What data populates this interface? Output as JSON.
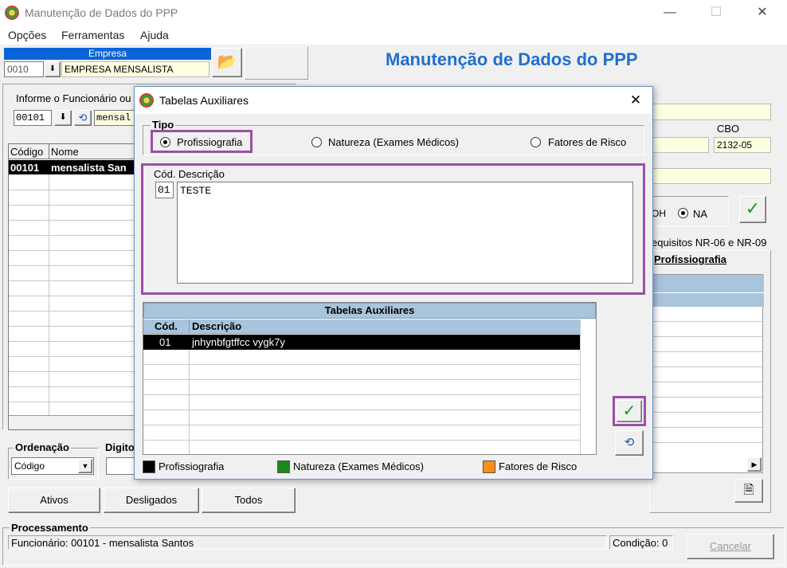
{
  "window": {
    "title": "Manutenção de Dados do PPP"
  },
  "menu": [
    "Opções",
    "Ferramentas",
    "Ajuda"
  ],
  "empresa": {
    "label": "Empresa",
    "code": "0010",
    "name": "EMPRESA MENSALISTA"
  },
  "header_title": "Manutenção de Dados do PPP",
  "funcionario": {
    "label": "Informe o Funcionário ou",
    "code": "00101",
    "name": "mensal"
  },
  "emp_table": {
    "col_code": "Código",
    "col_name": "Nome",
    "rows": [
      {
        "code": "00101",
        "name": "mensalista San"
      }
    ]
  },
  "right_panel": {
    "cbo_label": "CBO",
    "cbo_value": "2132-05",
    "radio_partial": "OH",
    "radio_na": "NA",
    "tab_req": "equisitos NR-06 e NR-09",
    "tab_prof": "Profissiografia"
  },
  "ordenacao": {
    "label": "Ordenação",
    "value": "Código",
    "digite_label": "Digito"
  },
  "filter_tabs": [
    "Ativos",
    "Desligados",
    "Todos"
  ],
  "processamento": {
    "label": "Processamento",
    "funcionario_text": "Funcionário: 00101 - mensalista Santos",
    "condicao_text": "Condição: 0",
    "cancel_label": "Cancelar"
  },
  "dialog": {
    "title": "Tabelas Auxiliares",
    "tipo_label": "Tipo",
    "tipo_options": [
      "Profissiografia",
      "Natureza (Exames Médicos)",
      "Fatores de Risco"
    ],
    "tipo_selected": 0,
    "cod_label": "Cód.",
    "desc_label": "Descrição",
    "cod_value": "01",
    "desc_value": "TESTE",
    "grid_title": "Tabelas Auxiliares",
    "grid_col_cod": "Cód.",
    "grid_col_desc": "Descrição",
    "grid_rows": [
      {
        "cod": "01",
        "desc": "jnhynbfgtffcc vygk7y"
      }
    ],
    "legend": [
      {
        "label": "Profissiografia",
        "color": "#000000"
      },
      {
        "label": "Natureza (Exames Médicos)",
        "color": "#1a8a1a"
      },
      {
        "label": "Fatores de Risco",
        "color": "#ff8c1a"
      }
    ]
  },
  "colors": {
    "accent_title": "#1f6fd0",
    "highlight": "#9b4fa5",
    "confirm_green": "#1a9a1a"
  }
}
